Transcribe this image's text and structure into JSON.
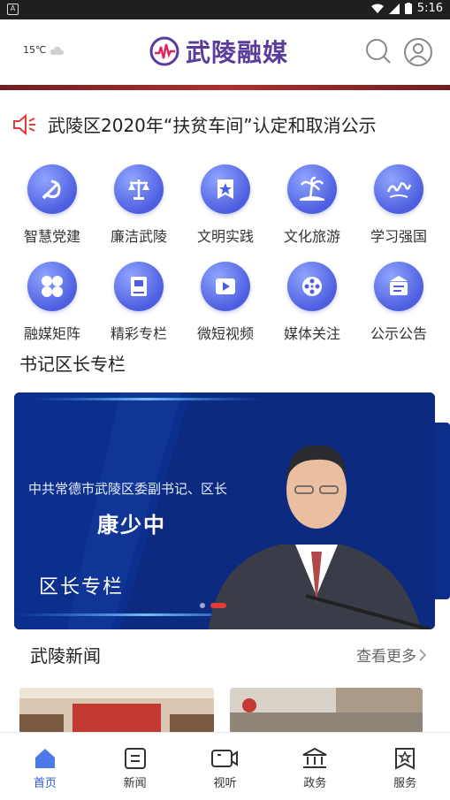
{
  "status_bar": {
    "time": "5:16"
  },
  "header": {
    "temperature": "15℃",
    "app_title": "武陵融媒"
  },
  "notice": {
    "text": "武陵区2020年“扶贫车间”认定和取消公示"
  },
  "grid": [
    {
      "label": "智慧党建",
      "icon": "party-emblem-icon"
    },
    {
      "label": "廉洁武陵",
      "icon": "scales-icon"
    },
    {
      "label": "文明实践",
      "icon": "star-badge-icon"
    },
    {
      "label": "文化旅游",
      "icon": "palm-tree-icon"
    },
    {
      "label": "学习强国",
      "icon": "xuexi-icon"
    },
    {
      "label": "融媒矩阵",
      "icon": "four-dots-icon"
    },
    {
      "label": "精彩专栏",
      "icon": "book-icon"
    },
    {
      "label": "微短视频",
      "icon": "video-play-icon"
    },
    {
      "label": "媒体关注",
      "icon": "film-reel-icon"
    },
    {
      "label": "公示公告",
      "icon": "notice-board-icon"
    }
  ],
  "section": {
    "title": "书记区长专栏"
  },
  "banner": {
    "subtitle": "中共常德市武陵区委副书记、区长",
    "name": "康少中",
    "column": "区长专栏"
  },
  "news": {
    "title": "武陵新闻",
    "more": "查看更多"
  },
  "tabs": [
    {
      "label": "首页",
      "icon": "home-icon",
      "active": true
    },
    {
      "label": "新闻",
      "icon": "news-icon",
      "active": false
    },
    {
      "label": "视听",
      "icon": "camera-icon",
      "active": false
    },
    {
      "label": "政务",
      "icon": "government-icon",
      "active": false
    },
    {
      "label": "服务",
      "icon": "service-icon",
      "active": false
    }
  ],
  "colors": {
    "accent": "#2d5bd8",
    "brand": "#5a3c9c",
    "icon_circle": "#5a6cf0",
    "banner_bg": "#0a2470"
  }
}
